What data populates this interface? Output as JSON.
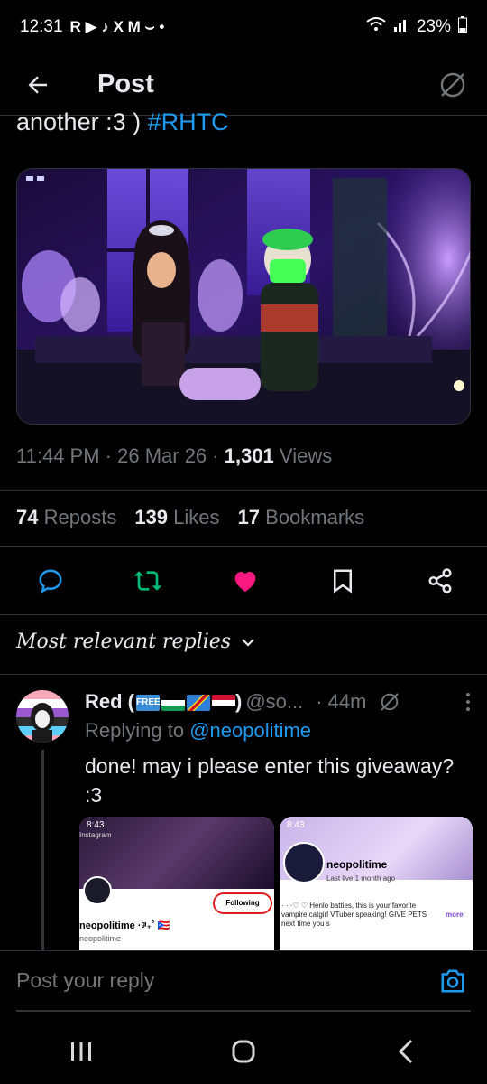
{
  "status_bar": {
    "time": "12:31",
    "apps": "R ▶ ♪ X M ⌣ •",
    "battery": "23%"
  },
  "header": {
    "title": "Post"
  },
  "tweet": {
    "text_prefix": "another :3 ) ",
    "hashtag": "#RHTC",
    "time": "11:44 PM",
    "date": "26 Mar 26",
    "views_count": "1,301",
    "views_label": "Views",
    "reposts_count": "74",
    "reposts_label": "Reposts",
    "likes_count": "139",
    "likes_label": "Likes",
    "bookmarks_count": "17",
    "bookmarks_label": "Bookmarks"
  },
  "sort_label": "Most relevant replies",
  "reply": {
    "name_prefix": "Red (",
    "name_suffix": ")",
    "handle": "@so...",
    "time": "· 44m",
    "replying_label": "Replying to ",
    "replying_to": "@neopolitime",
    "body": "done! may i please enter this giveaway? :3",
    "shot1": {
      "status_time": "8:43",
      "app": "Instagram",
      "button": "Following",
      "username": "neopolitime ·ᵍᶦ₊˚ 🇵🇷",
      "sub": "neopolitime"
    },
    "shot2": {
      "status_time": "8:43",
      "name": "neopolitime",
      "last_live": "Last live 1 month ago",
      "bio": "· · ·♡ ♡ Henlo batties, this is your favorite vampire catgirl VTuber speaking! GIVE PETS next time you s",
      "more": "more"
    }
  },
  "reply_bar": {
    "placeholder": "Post your reply"
  },
  "colors": {
    "accent": "#1d9bf0",
    "like": "#f91880",
    "repost": "#00ba7c",
    "muted": "#71767b"
  }
}
